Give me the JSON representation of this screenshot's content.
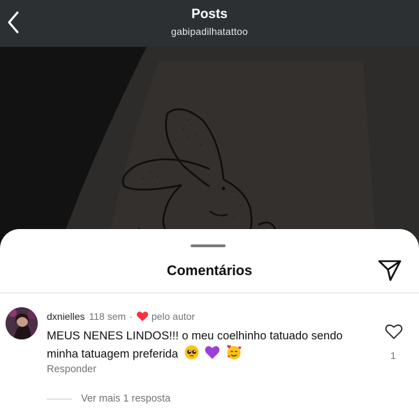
{
  "header": {
    "title": "Posts",
    "subtitle": "gabipadilhatattoo",
    "back_icon": "chevron-left-icon"
  },
  "sheet": {
    "title": "Comentários",
    "share_icon": "paper-plane-icon"
  },
  "comment": {
    "username": "dxnielles",
    "time": "118 sem",
    "separator": "·",
    "liked_by_author_label": "pelo autor",
    "text": "MEUS NENES LINDOS!!! o meu coelhinho tatuado sendo minha tatuagem preferida",
    "emojis": [
      "pleading-face-emoji",
      "purple-heart-emoji",
      "smiling-face-with-hearts-emoji"
    ],
    "reply_label": "Responder",
    "like_count": "1",
    "more_replies_label": "Ver mais 1 resposta"
  },
  "colors": {
    "header_bg": "#2d3032",
    "author_heart": "#ff3040",
    "muted_text": "#737373"
  }
}
